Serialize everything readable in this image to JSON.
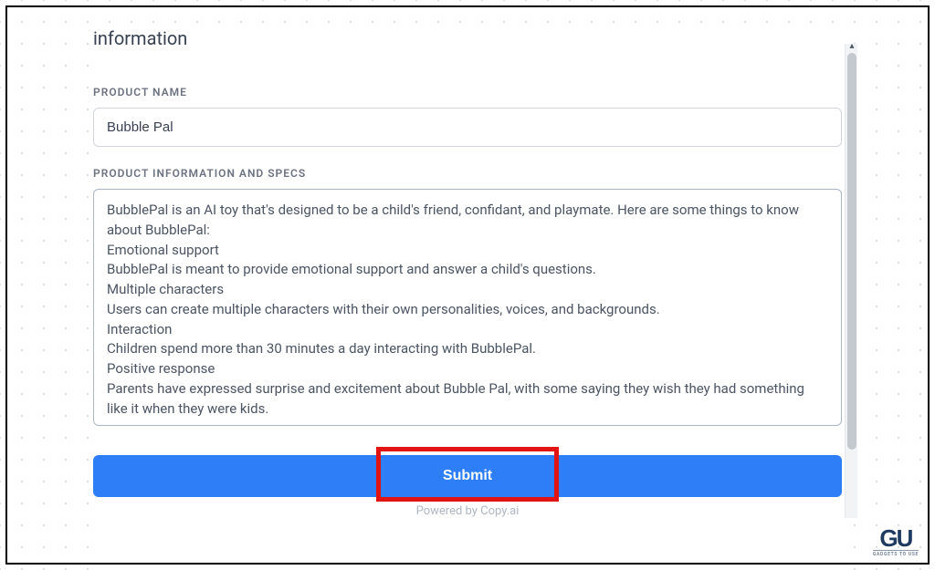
{
  "header_fragment": "information",
  "fields": {
    "product_name": {
      "label": "PRODUCT NAME",
      "value": "Bubble Pal"
    },
    "product_info": {
      "label": "PRODUCT INFORMATION AND SPECS",
      "value": "BubblePal is an AI toy that's designed to be a child's friend, confidant, and playmate. Here are some things to know about BubblePal:\nEmotional support\nBubblePal is meant to provide emotional support and answer a child's questions.\nMultiple characters\nUsers can create multiple characters with their own personalities, voices, and backgrounds.\nInteraction\nChildren spend more than 30 minutes a day interacting with BubblePal.\nPositive response\nParents have expressed surprise and excitement about Bubble Pal, with some saying they wish they had something like it when they were kids."
    }
  },
  "submit_label": "Submit",
  "powered_text": "Powered by Copy.ai",
  "watermark": {
    "main": "GU",
    "sub": "GADGETS TO USE"
  }
}
